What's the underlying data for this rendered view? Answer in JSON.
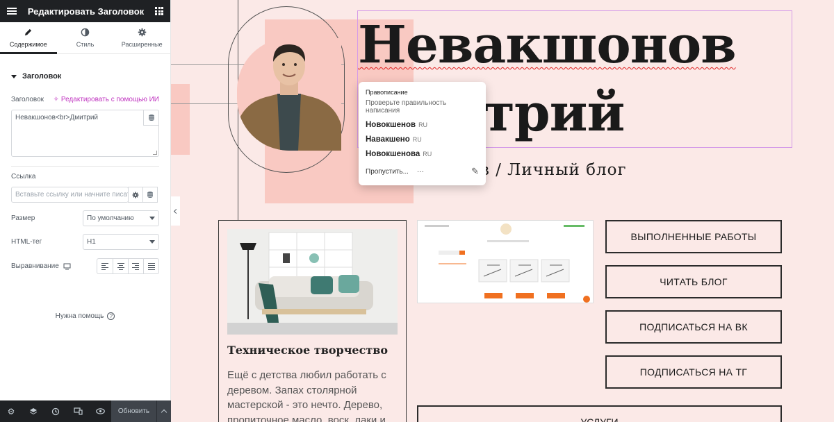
{
  "editor": {
    "title": "Редактировать Заголовок",
    "tabs": [
      {
        "label": "Содержимое"
      },
      {
        "label": "Стиль"
      },
      {
        "label": "Расширенные"
      }
    ],
    "section_title": "Заголовок",
    "heading_label": "Заголовок",
    "ai_link": "Редактировать с помощью ИИ",
    "heading_value": "Невакшонов<br>Дмитрий",
    "link_label": "Ссылка",
    "link_placeholder": "Вставьте ссылку или начните писать",
    "size_label": "Размер",
    "size_value": "По умолчанию",
    "tag_label": "HTML-тег",
    "tag_value": "H1",
    "align_label": "Выравнивание",
    "help": "Нужна помощь",
    "update_button": "Обновить"
  },
  "page": {
    "heading_line1": "Невакшонов",
    "heading_line2": "Дмитрий",
    "heading_line2_visible": "трий",
    "subtitle": "ов / Личный блог",
    "card": {
      "title": "Техническое творчество",
      "text": "Ещё с детства любил работать с деревом. Запах столярной мастерской - это нечто. Дерево, пропиточное масло, воск, лаки и"
    },
    "buttons": [
      "ВЫПОЛНЕННЫЕ РАБОТЫ",
      "ЧИТАТЬ БЛОГ",
      "ПОДПИСАТЬСЯ НА ВК",
      "ПОДПИСАТЬСЯ НА ТГ"
    ],
    "services": "УСЛУГИ"
  },
  "spellcheck": {
    "title": "Правописание",
    "subtitle": "Проверьте правильность написания",
    "suggestions": [
      {
        "word": "Новокшенов",
        "lang": "RU"
      },
      {
        "word": "Навакшено",
        "lang": "RU"
      },
      {
        "word": "Новокшенова",
        "lang": "RU"
      }
    ],
    "skip": "Пропустить...",
    "more": "···"
  },
  "colors": {
    "sidebar_dark": "#1f2124",
    "ai_accent": "#c036c0",
    "page_bg": "#fbe9e7",
    "accent_pink": "#f9c9c2",
    "heading_outline": "#d59be8"
  }
}
